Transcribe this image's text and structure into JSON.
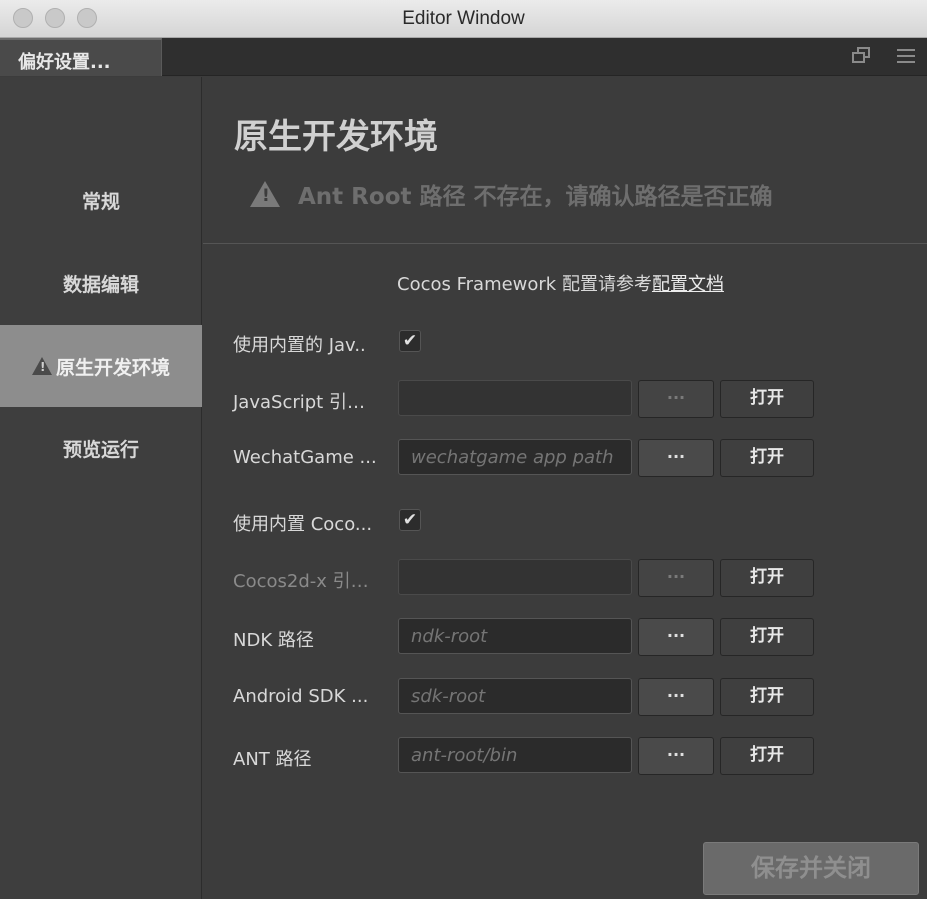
{
  "window": {
    "title": "Editor Window"
  },
  "tab": {
    "label": "偏好设置..."
  },
  "sidebar": {
    "items": [
      {
        "label": "常规"
      },
      {
        "label": "数据编辑"
      },
      {
        "label": "原生开发环境",
        "active": true,
        "warning": true
      },
      {
        "label": "预览运行"
      }
    ]
  },
  "main": {
    "title": "原生开发环境",
    "warning": "Ant Root 路径 不存在，请确认路径是否正确",
    "framework_note": "Cocos Framework 配置请参考",
    "framework_link": "配置文档",
    "rows": [
      {
        "label": "使用内置的 Jav..",
        "type": "checkbox",
        "checked": true
      },
      {
        "label": "JavaScript 引…",
        "type": "path",
        "value": "",
        "placeholder": "",
        "disabled": true,
        "browse": "···",
        "open": "打开"
      },
      {
        "label": "WechatGame ...",
        "type": "path",
        "value": "",
        "placeholder": "wechatgame app path",
        "browse": "···",
        "open": "打开"
      },
      {
        "label": "使用内置 Coco...",
        "type": "checkbox",
        "checked": true
      },
      {
        "label": "Cocos2d-x 引…",
        "type": "path",
        "value": "",
        "placeholder": "",
        "disabled": true,
        "browse": "···",
        "open": "打开"
      },
      {
        "label": "NDK 路径",
        "type": "path",
        "value": "",
        "placeholder": "ndk-root",
        "browse": "···",
        "open": "打开"
      },
      {
        "label": "Android SDK ...",
        "type": "path",
        "value": "",
        "placeholder": "sdk-root",
        "browse": "···",
        "open": "打开"
      },
      {
        "label": "ANT 路径",
        "type": "path",
        "value": "",
        "placeholder": "ant-root/bin",
        "browse": "···",
        "open": "打开"
      }
    ],
    "save_button": "保存并关闭"
  },
  "icons": {
    "restore": "restore-window-icon",
    "menu": "hamburger-menu-icon",
    "warning": "warning-icon",
    "check": "checkmark-icon"
  }
}
